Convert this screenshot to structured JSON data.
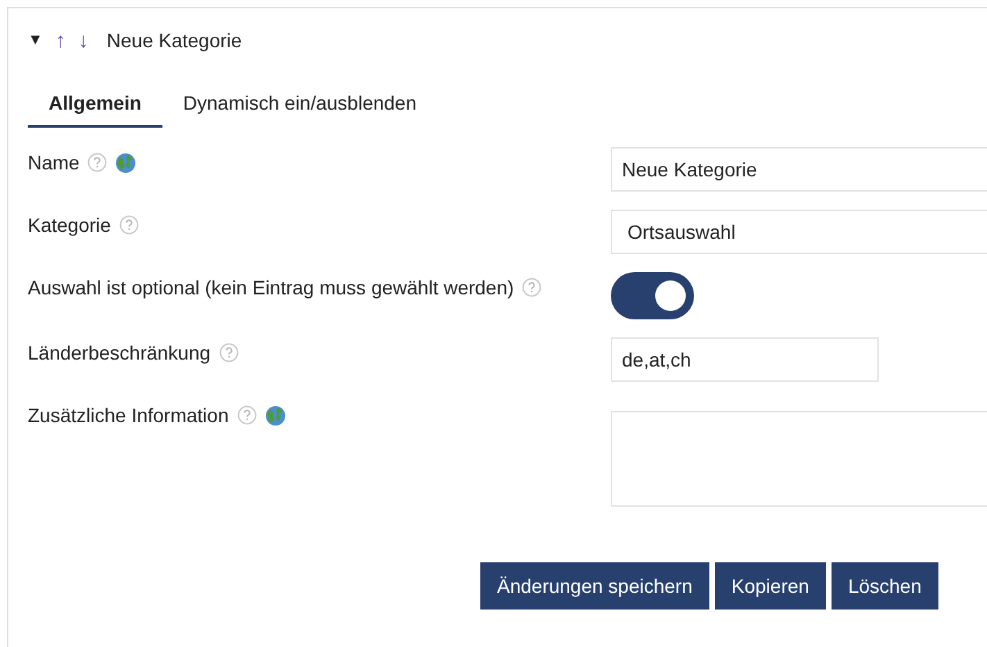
{
  "header": {
    "toggle": "▼",
    "move_up": "↑",
    "move_down": "↓",
    "title": "Neue Kategorie",
    "expanded": true
  },
  "tabs": [
    {
      "label": "Allgemein",
      "selected": true
    },
    {
      "label": "Dynamisch ein/ausblenden",
      "selected": false
    }
  ],
  "fields": [
    {
      "kind": "text",
      "label": "Name",
      "help": true,
      "translatable": true,
      "value": "Neue Kategorie"
    },
    {
      "kind": "select",
      "label": "Kategorie",
      "help": true,
      "translatable": false,
      "value": "Ortsauswahl"
    },
    {
      "kind": "toggle",
      "label": "Auswahl ist optional (kein Eintrag muss gewählt werden)",
      "help": true,
      "translatable": false,
      "on": true
    },
    {
      "kind": "short",
      "label": "Länderbeschränkung",
      "help": true,
      "translatable": false,
      "value": "de,at,ch"
    },
    {
      "kind": "textarea",
      "label": "Zusätzliche Information",
      "help": true,
      "translatable": true
    }
  ],
  "buttons": [
    "Änderungen speichern",
    "Kopieren",
    "Löschen"
  ]
}
